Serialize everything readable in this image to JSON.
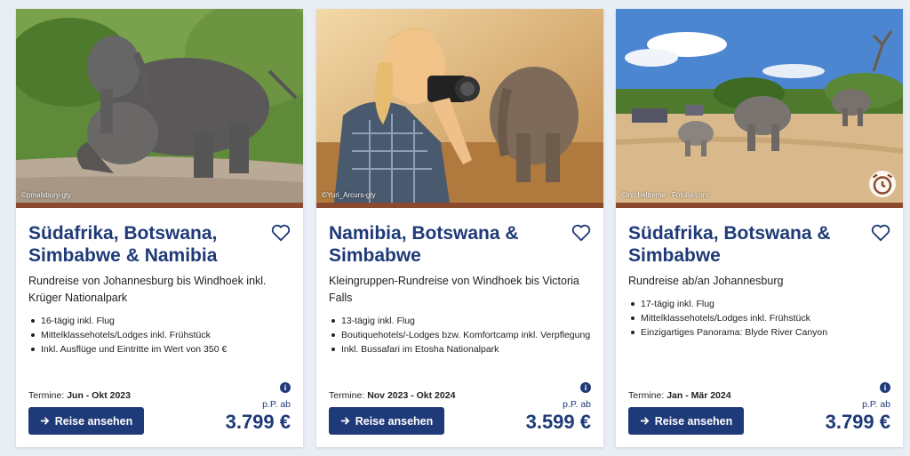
{
  "cards": [
    {
      "title": "Südafrika, Botswana, Simbabwe & Namibia",
      "subtitle": "Rundreise von Johannesburg bis Windhoek inkl. Krüger Nationalpark",
      "features": [
        "16-tägig inkl. Flug",
        "Mittelklassehotels/Lodges inkl. Frühstück",
        "Inkl. Ausflüge und Eintritte im Wert von 350 €"
      ],
      "dates_label": "Termine: ",
      "dates_value": "Jun - Okt 2023",
      "pp_label": "p.P. ab",
      "price": "3.799 €",
      "button_label": "Reise ansehen",
      "image_credit": "©pmalsbury-gty",
      "image_icon": "elephants-playing-image"
    },
    {
      "title": "Namibia, Botswana & Simbabwe",
      "subtitle": "Kleingruppen-Rundreise von Windhoek bis Victoria Falls",
      "features": [
        "13-tägig inkl. Flug",
        "Boutiquehotels/-Lodges bzw. Komfortcamp inkl. Verpflegung",
        "Inkl. Bussafari im Etosha Nationalpark"
      ],
      "dates_label": "Termine: ",
      "dates_value": "Nov 2023 - Okt 2024",
      "pp_label": "p.P. ab",
      "price": "3.599 €",
      "button_label": "Reise ansehen",
      "image_credit": "©Yuri_Arcurs-gty",
      "image_icon": "photographer-elephant-image"
    },
    {
      "title": "Südafrika, Botswana & Simbabwe",
      "subtitle": "Rundreise ab/an Johannesburg",
      "features": [
        "17-tägig inkl. Flug",
        "Mittelklassehotels/Lodges inkl. Frühstück",
        "Einzigartiges Panorama: Blyde River Canyon"
      ],
      "dates_label": "Termine: ",
      "dates_value": "Jan - Mär 2024",
      "pp_label": "p.P. ab",
      "price": "3.799 €",
      "button_label": "Reise ansehen",
      "image_credit": "©ino beltreme - Fotolia.com",
      "image_icon": "safari-elephants-image"
    }
  ],
  "colors": {
    "brand_blue": "#1f3a78",
    "bar_brown": "#8b4a2e",
    "background": "#e9eef5"
  },
  "icons": {
    "heart": "heart-icon",
    "info": "info-icon",
    "arrow": "arrow-right-icon",
    "alarm": "alarm-clock-icon"
  }
}
